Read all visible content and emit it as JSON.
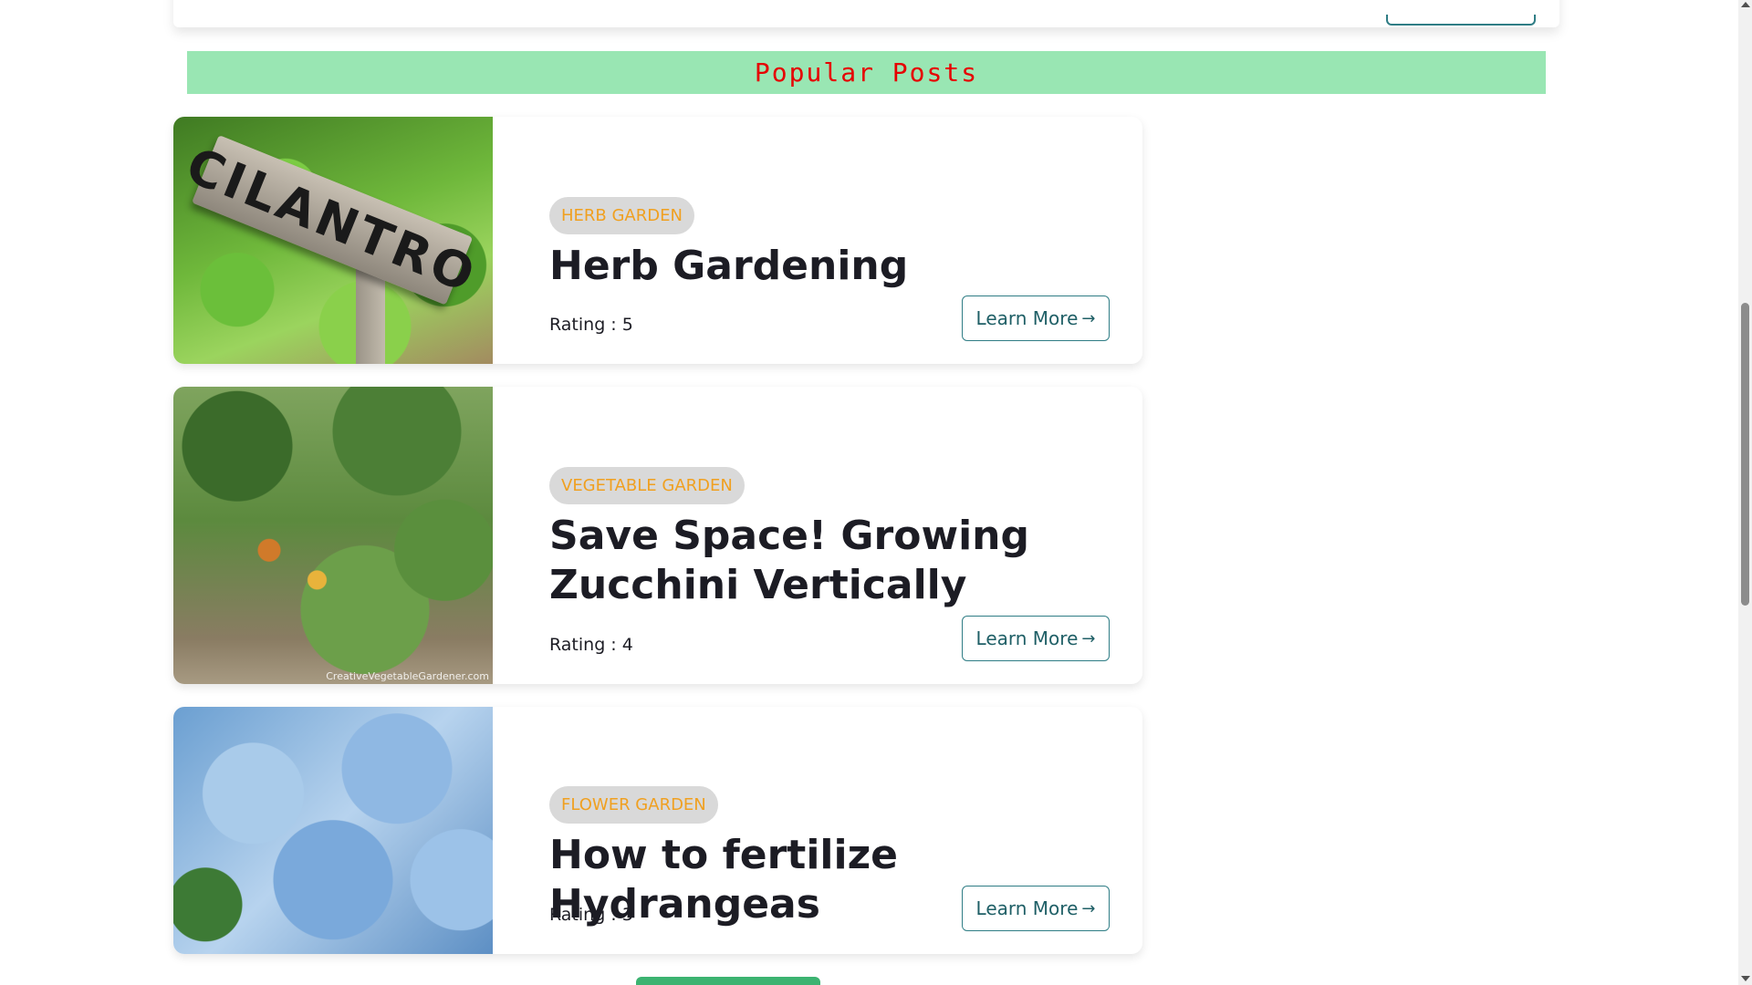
{
  "section": {
    "title": "Popular Posts"
  },
  "posts": [
    {
      "category": "HERB GARDEN",
      "title": "Herb Gardening",
      "rating_label": "Rating : ",
      "rating": "5",
      "button_label": "Learn More",
      "image_text": "CILANTRO"
    },
    {
      "category": "VEGETABLE GARDEN",
      "title": "Save Space! Growing Zucchini Vertically",
      "rating_label": "Rating : ",
      "rating": "4",
      "button_label": "Learn More",
      "image_text": "CreativeVegetableGardener.com"
    },
    {
      "category": "FLOWER GARDEN",
      "title": "How to fertilize Hydrangeas",
      "rating_label": "Rating : ",
      "rating": "3",
      "button_label": "Learn More"
    }
  ],
  "icons": {
    "arrow": "arrow-right-icon"
  },
  "colors": {
    "header_bg": "#99e6b3",
    "header_text": "#e60000",
    "badge_bg": "#d9d9d9",
    "badge_text": "#f0a020",
    "button_border": "#2f7d85",
    "bottom_button": "#3cb371"
  },
  "scrollbar": {
    "position_fraction": 0.31
  }
}
